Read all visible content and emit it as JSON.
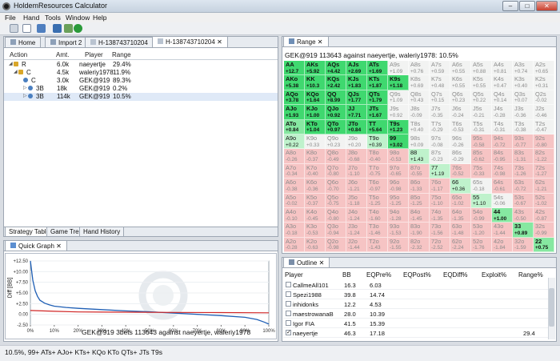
{
  "window": {
    "title": "HoldemResources Calculator",
    "min": "–",
    "max": "□",
    "close": "✕"
  },
  "menu": [
    "File",
    "Hand",
    "Tools",
    "Window",
    "Help"
  ],
  "editor_tabs": [
    {
      "label": "Home",
      "icon": "home-icon"
    },
    {
      "label": "Import 2",
      "icon": "import-icon"
    },
    {
      "label": "H-138743710204",
      "icon": "hand-file-icon"
    },
    {
      "label": "H-138743710204",
      "icon": "hand-file-icon",
      "active": true
    }
  ],
  "range_tab": "Range",
  "tree": {
    "headers": [
      "Action",
      "Amt.",
      "Player",
      "Range"
    ],
    "rows": [
      {
        "action": "R",
        "amt": "6.0k",
        "player": "naeyertje",
        "range": "29.4%"
      },
      {
        "action": "C",
        "amt": "4.5k",
        "player": "waleriy1978",
        "range": "11.9%"
      },
      {
        "action": "C",
        "amt": "3.0k",
        "player": "GEK@919",
        "range": "89.3%"
      },
      {
        "action": "3B",
        "amt": "18k",
        "player": "GEK@919",
        "range": "0.2%"
      },
      {
        "action": "3B",
        "amt": "114k",
        "player": "GEK@919",
        "range": "10.5%"
      }
    ]
  },
  "bottom_tabs": [
    "Strategy Table",
    "Game Tree",
    "Hand History"
  ],
  "quick_graph": {
    "tab": "Quick Graph",
    "title": "GEK@919 3bets 113643 against naeyertje, waleriy1978"
  },
  "chart_data": {
    "type": "line",
    "title": "GEK@919 3bets 113643 against naeyertje, waleriy1978",
    "xlabel": "",
    "ylabel": "Diff [BB]",
    "yticks": [
      "+12.50",
      "+10.00",
      "+7.50",
      "+5.00",
      "+2.50",
      "0.00",
      "-2.50"
    ],
    "xticks": [
      "0%",
      "10%",
      "20%",
      "30%",
      "40%",
      "50%",
      "60%",
      "70%",
      "80%",
      "90%",
      "100%"
    ],
    "ylim": [
      -2.5,
      12.5
    ],
    "series": [
      {
        "color": "#1f5fb5",
        "x": [
          0,
          1,
          2,
          3,
          4,
          6,
          8,
          10,
          15,
          20,
          30,
          40,
          50,
          60,
          70,
          80,
          90,
          95,
          98,
          100
        ],
        "y": [
          12.5,
          8,
          5.5,
          4.2,
          3.3,
          2.6,
          2.2,
          1.9,
          1.6,
          1.4,
          1.1,
          0.8,
          0.6,
          0.3,
          0,
          -0.3,
          -0.7,
          -1.2,
          -1.8,
          -2.3
        ]
      },
      {
        "color": "#d02525",
        "x": [
          0,
          10,
          20,
          40,
          60,
          80,
          100
        ],
        "y": [
          0.9,
          0.7,
          0.55,
          0.5,
          0.45,
          0.4,
          0.35
        ]
      }
    ]
  },
  "range": {
    "header": "GEK@919 113643 against naeyertje, waleriy1978: 10.5%",
    "grid": [
      [
        "AA|+12.7|g3",
        "AKs|+5.92|g3",
        "AQs|+4.42|g3",
        "AJs|+2.69|g3",
        "ATs|+1.69|g3",
        "A9s|+1.09|g0",
        "A8s|+0.76|g0",
        "A7s|+0.59|g0",
        "A6s|+0.55|g0",
        "A5s|+0.88|g0",
        "A4s|+0.81|g0",
        "A3s|+0.74|g0",
        "A2s|+0.65|g0"
      ],
      [
        "AKo|+5.38|g3",
        "KK|+10.3|g3",
        "KQs|+2.42|g3",
        "KJs|+1.83|g3",
        "KTs|+1.87|g3",
        "K9s|+1.18|g3",
        "K8s|+0.69|g0",
        "K7s|+0.48|g0",
        "K6s|+0.55|g0",
        "K5s|+0.55|g0",
        "K4s|+0.47|g0",
        "K3s|+0.40|g0",
        "K2s|+0.31|g0"
      ],
      [
        "AQo|+3.78|g3",
        "KQo|+1.64|g3",
        "QQ|+8.99|g3",
        "QJs|+1.77|g3",
        "QTs|+1.79|g3",
        "Q9s|+1.09|g0",
        "Q8s|+0.43|g0",
        "Q7s|+0.15|g0",
        "Q6s|+0.23|g0",
        "Q5s|+0.22|g0",
        "Q4s|+0.14|g0",
        "Q3s|+0.07|g0",
        "Q2s|-0.02|g0"
      ],
      [
        "AJo|+1.93|g3",
        "KJo|+1.00|g3",
        "QJo|+0.92|g3",
        "JJ|+7.71|g3",
        "JTs|+1.67|g3",
        "J9s|+0.92|g0",
        "J8s|-0.09|g0",
        "J7s|-0.35|g0",
        "J6s|-0.24|g0",
        "J5s|-0.21|g0",
        "J4s|-0.28|g0",
        "J3s|-0.36|g0",
        "J2s|-0.46|g0"
      ],
      [
        "ATo|+0.84|g2",
        "KTo|+1.04|g3",
        "QTo|+0.97|g3",
        "JTo|+0.84|g3",
        "TT|+5.64|g3",
        "T9s|+1.23|g3",
        "T8s|+0.40|g0",
        "T7s|-0.29|g0",
        "T6s|-0.53|g0",
        "T5s|-0.31|g0",
        "T4s|-0.31|g0",
        "T3s|-0.38|g0",
        "T2s|-0.47|g0"
      ],
      [
        "A9o|+0.22|g1",
        "K9o|+0.33|g0",
        "Q9o|+0.23|g0",
        "J9o|+0.20|g0",
        "T9o|+0.39|g1",
        "99|+3.02|g3",
        "98s|+0.09|g0",
        "97s|-0.08|g0",
        "96s|-0.26|g0",
        "95s|-0.58|r",
        "94s|-0.72|r",
        "93s|-0.77|r",
        "92s|-0.80|r"
      ],
      [
        "A8o|-0.26|r",
        "K8o|-0.37|r",
        "Q8o|-0.49|r",
        "J8o|-0.68|r",
        "T8o|-0.40|r",
        "98o|-0.53|r",
        "88|+1.43|g1",
        "87s|-0.23|g0",
        "86s|-0.29|g0",
        "85s|-0.62|r",
        "84s|-0.95|r",
        "83s|-1.31|r",
        "82s|-1.22|r"
      ],
      [
        "A7o|-0.34|r",
        "K7o|-0.40|r",
        "Q7o|-0.80|r",
        "J7o|-1.10|r",
        "T7o|-0.75|r",
        "97o|-0.65|r",
        "87o|-0.55|r",
        "77|+1.19|g1",
        "76s|-0.52|r",
        "75s|-0.33|r",
        "74s|-0.98|r",
        "73s|-1.26|r",
        "72s|-1.27|r"
      ],
      [
        "A6o|-0.38|r",
        "K6o|-0.36|r",
        "Q6o|-0.70|r",
        "J6o|-1.21|r",
        "T6o|-0.97|r",
        "96o|-0.98|r",
        "86o|-1.33|r",
        "76o|-1.17|r",
        "66|+0.36|g1",
        "65s|-0.18|g0",
        "64s|-0.61|r",
        "63s|-0.72|r",
        "62s|-1.21|r"
      ],
      [
        "A5o|-0.02|r",
        "K5o|-0.37|r",
        "Q5o|-0.75|r",
        "J5o|-1.18|r",
        "T5o|-1.25|r",
        "95o|-1.25|r",
        "85o|-1.25|r",
        "75o|-1.10|r",
        "65o|-1.02|r",
        "55|+1.10|g1",
        "54s|-0.06|g0",
        "53s|-0.67|r",
        "52s|-1.02|r"
      ],
      [
        "A4o|-0.10|r",
        "K4o|-0.45|r",
        "Q4o|-0.80|r",
        "J4o|-1.24|r",
        "T4o|-1.60|r",
        "94o|-1.28|r",
        "84o|-1.45|r",
        "74o|-1.35|r",
        "64o|-1.35|r",
        "54o|-0.99|r",
        "44|+1.00|g2",
        "43s|-0.50|r",
        "42s|-0.87|r"
      ],
      [
        "A3o|-0.18|r",
        "K3o|-0.53|r",
        "Q3o|-0.94|r",
        "J3o|-1.24|r",
        "T3o|-1.46|r",
        "93o|-1.53|r",
        "83o|-1.90|r",
        "73o|-1.56|r",
        "63o|-1.48|r",
        "53o|-1.20|r",
        "43o|-1.44|r",
        "33|+0.89|g2",
        "32s|-0.99|r"
      ],
      [
        "A2o|-0.28|r",
        "K2o|-0.63|r",
        "Q2o|-0.98|r",
        "J2o|-1.44|r",
        "T2o|-1.43|r",
        "92o|-1.55|r",
        "82o|-2.32|r",
        "72o|-2.52|r",
        "62o|-2.24|r",
        "52o|-1.76|r",
        "42o|-1.84|r",
        "32o|-1.59|r",
        "22|+0.75|g2"
      ]
    ]
  },
  "outline": {
    "tab": "Outline",
    "headers": [
      "Player",
      "BB",
      "EQPre%",
      "EQPost%",
      "EQDiff%",
      "Exploit%",
      "Range%"
    ],
    "rows": [
      {
        "player": "CallmeAll101",
        "bb": "16.3",
        "eqpre": "6.03",
        "eqpost": "",
        "eqdiff": "",
        "exploit": "",
        "range": "",
        "checked": false
      },
      {
        "player": "Spezi1988",
        "bb": "39.8",
        "eqpre": "14.74",
        "eqpost": "",
        "eqdiff": "",
        "exploit": "",
        "range": "",
        "checked": false
      },
      {
        "player": "inhidonks",
        "bb": "12.2",
        "eqpre": "4.53",
        "eqpost": "",
        "eqdiff": "",
        "exploit": "",
        "range": "",
        "checked": false
      },
      {
        "player": "maestrowanaB",
        "bb": "28.0",
        "eqpre": "10.39",
        "eqpost": "",
        "eqdiff": "",
        "exploit": "",
        "range": "",
        "checked": false
      },
      {
        "player": "Igor FIA",
        "bb": "41.5",
        "eqpre": "15.39",
        "eqpost": "",
        "eqdiff": "",
        "exploit": "",
        "range": "",
        "checked": false
      },
      {
        "player": "naeyertje",
        "bb": "46.3",
        "eqpre": "17.18",
        "eqpost": "",
        "eqdiff": "",
        "exploit": "",
        "range": "29.4",
        "checked": true
      }
    ]
  },
  "status": "10.5%, 99+ ATs+ AJo+ KTs+ KQo KTo QTs+ JTs T9s"
}
